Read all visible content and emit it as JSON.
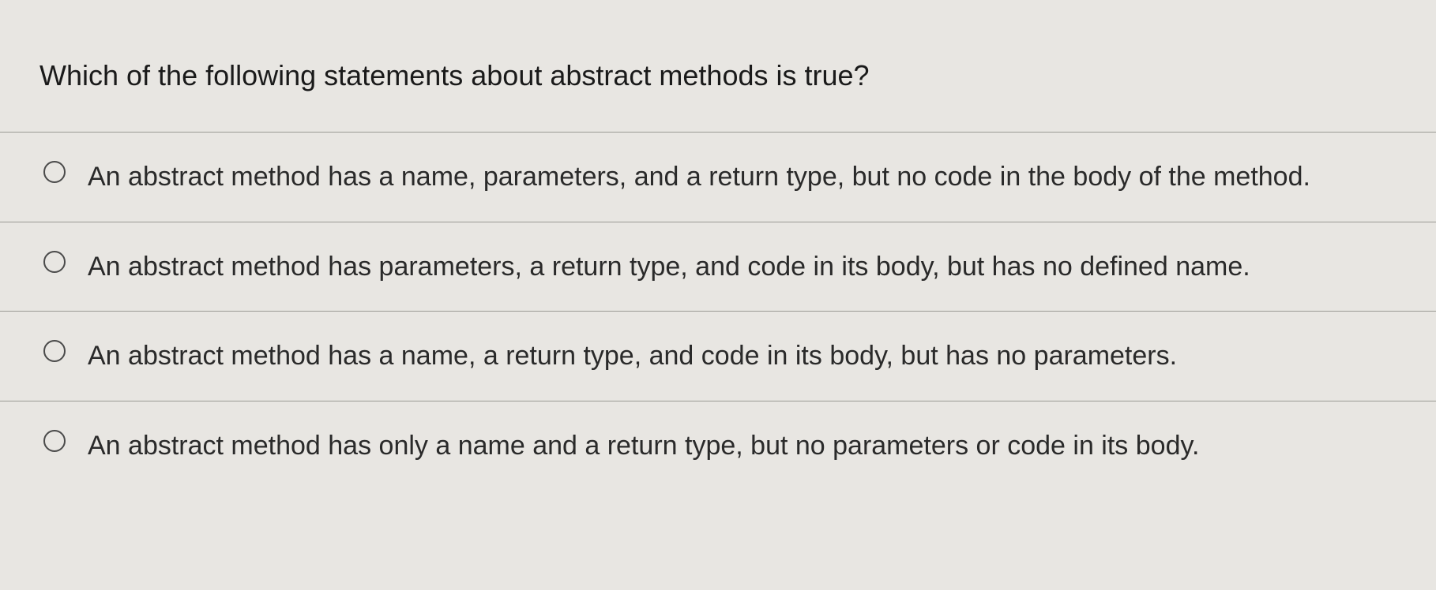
{
  "question": {
    "prompt": "Which of the following statements about abstract methods is true?",
    "options": [
      {
        "label": "An abstract method has a name, parameters, and a return type, but no code in the body of the method."
      },
      {
        "label": "An abstract method has parameters, a return type, and code in its body, but has no defined name."
      },
      {
        "label": "An abstract method has a name, a return type, and code in its body, but has no parameters."
      },
      {
        "label": "An abstract method has only a name and a return type, but no parameters or code in its body."
      }
    ]
  }
}
